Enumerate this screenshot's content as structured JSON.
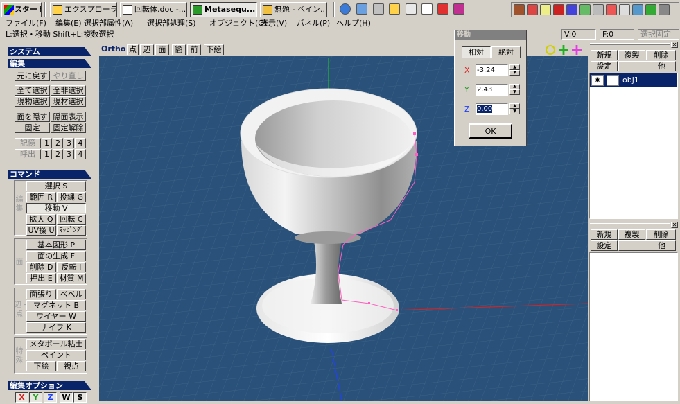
{
  "taskbar": {
    "start_label": "スタート",
    "tasks": [
      {
        "label": "エクスプローラ..."
      },
      {
        "label": "回転体.doc -..."
      },
      {
        "label": "Metasequ..."
      },
      {
        "label": "無題 - ペイン..."
      }
    ]
  },
  "menubar": {
    "items": [
      "ファイル(F)",
      "編集(E)",
      "選択部属性(A)",
      "選択部処理(S)",
      "オブジェクト(O)",
      "表示(V)",
      "パネル(P)",
      "ヘルプ(H)"
    ]
  },
  "statusbar": {
    "hint": "L:選択・移動  Shift+L:複数選択",
    "v_count": "V:0",
    "f_count": "F:0",
    "lock_label": "選択固定"
  },
  "left_panel": {
    "system_header": "システム",
    "edit_header": "編集",
    "undo": "元に戻す",
    "redo": "やり直し",
    "select_all": "全て選択",
    "deselect_all": "全非選択",
    "select_object": "現物選択",
    "select_material": "現材選択",
    "hide_face": "面を隠す",
    "show_hidden": "隠面表示",
    "fix": "固定",
    "unfix": "固定解除",
    "memory": "記憶",
    "recall": "呼出",
    "slot_1": "1",
    "slot_2": "2",
    "slot_3": "3",
    "slot_4": "4",
    "command_header": "コマンド",
    "group_edit_label": "編集",
    "select": "選択 S",
    "range": "範囲 R",
    "lasso": "投縄 G",
    "move": "移動 V",
    "scale": "拡大 Q",
    "rotate": "回転 C",
    "uv": "UV操 U",
    "mapping": "ﾏｯﾋﾟﾝｸﾞ",
    "group_face_label": "面",
    "primitive": "基本図形 P",
    "face_create": "面の生成 F",
    "delete": "削除 D",
    "flip": "反転 I",
    "extrude": "押出 E",
    "material": "材質 M",
    "group_edge_label": "辺・点",
    "face_stretch": "面張り",
    "bevel": "ベベル",
    "magnet": "マグネット B",
    "wire": "ワイヤー W",
    "knife": "ナイフ K",
    "group_special_label": "特殊",
    "metaball": "メタボール粘土",
    "paint": "ペイント",
    "lower": "下絵",
    "viewpoint": "視点",
    "edit_options_header": "編集オプション",
    "opt_x": "X",
    "opt_y": "Y",
    "opt_z": "Z",
    "opt_w": "W",
    "opt_s": "S"
  },
  "viewport": {
    "mode": "Ortho",
    "btn_point": "点",
    "btn_edge": "辺",
    "btn_face": "面",
    "btn_simple": "簡",
    "btn_front": "前",
    "btn_underlay": "下絵"
  },
  "move_dialog": {
    "title": "移動",
    "relative": "相対",
    "absolute": "絶対",
    "x_label": "X",
    "y_label": "Y",
    "z_label": "Z",
    "x_value": "-3.24",
    "y_value": "2.43",
    "z_value": "0.00",
    "ok": "OK"
  },
  "object_panel": {
    "new": "新規",
    "copy": "複製",
    "delete": "削除",
    "settings": "設定",
    "other": "他",
    "object_name": "obj1"
  },
  "material_panel": {
    "new": "新規",
    "copy": "複製",
    "delete": "削除",
    "settings": "設定",
    "other": "他"
  },
  "colors": {
    "viewport_bg": "#2a5179",
    "title_active": "#0a246a",
    "x_axis": "#e02020",
    "y_axis": "#20d020",
    "z_axis": "#2040ff"
  }
}
